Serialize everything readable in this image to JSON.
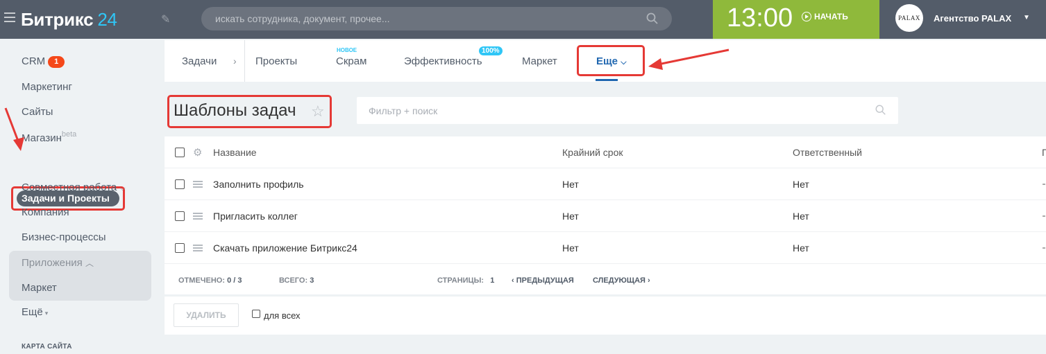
{
  "header": {
    "logo_main": "Битрикс",
    "logo_num": "24",
    "search_placeholder": "искать сотрудника, документ, прочее...",
    "time": "13:00",
    "start_label": "НАЧАТЬ",
    "avatar_text": "PALAX",
    "user_name": "Агентство PALAX"
  },
  "sidebar": {
    "crm": "CRM",
    "crm_badge": "1",
    "marketing": "Маркетинг",
    "sites": "Сайты",
    "shop": "Магазин",
    "shop_beta": "beta",
    "tasks": "Задачи и Проекты",
    "collab": "Совместная работа",
    "company": "Компания",
    "bizproc": "Бизнес-процессы",
    "apps": "Приложения",
    "market": "Маркет",
    "more": "Ещё",
    "sitemap": "КАРТА САЙТА"
  },
  "tabs": {
    "tasks": "Задачи",
    "projects": "Проекты",
    "scrum": "Скрам",
    "scrum_new": "НОВОЕ",
    "efficiency": "Эффективность",
    "efficiency_badge": "100%",
    "market": "Маркет",
    "more": "Еще"
  },
  "page": {
    "title": "Шаблоны задач",
    "filter_placeholder": "Фильтр + поиск"
  },
  "grid": {
    "columns": [
      "Название",
      "Крайний срок",
      "Ответственный",
      "П"
    ],
    "rows": [
      {
        "name": "Заполнить профиль",
        "deadline": "Нет",
        "responsible": "Нет"
      },
      {
        "name": "Пригласить коллег",
        "deadline": "Нет",
        "responsible": "Нет"
      },
      {
        "name": "Скачать приложение Битрикс24",
        "deadline": "Нет",
        "responsible": "Нет"
      }
    ],
    "footer": {
      "checked_label": "ОТМЕЧЕНО:",
      "checked_value": "0 / 3",
      "total_label": "ВСЕГО:",
      "total_value": "3",
      "pages_label": "СТРАНИЦЫ:",
      "pages_value": "1",
      "prev": "ПРЕДЫДУЩАЯ",
      "next": "СЛЕДУЮЩАЯ"
    }
  },
  "actions": {
    "delete": "УДАЛИТЬ",
    "for_all": "для всех"
  },
  "colors": {
    "header_bg": "#535c69",
    "accent_blue": "#2fc6f6",
    "time_green": "#8fb93b",
    "highlight_red": "#e53935",
    "link_blue": "#2067b0"
  }
}
